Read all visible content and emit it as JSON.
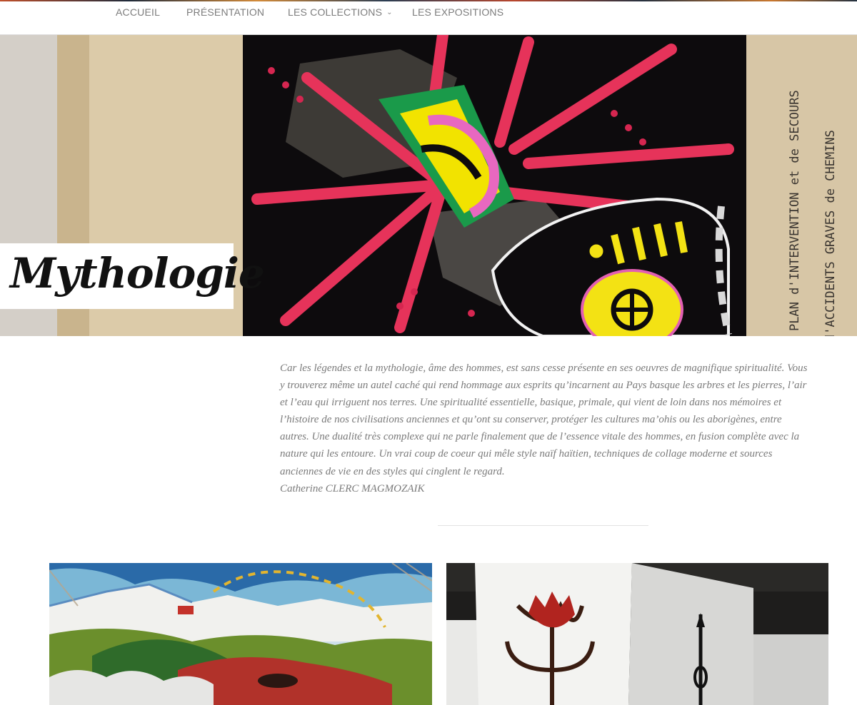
{
  "nav": {
    "items": [
      {
        "label": "ACCUEIL"
      },
      {
        "label": "PRÉSENTATION"
      },
      {
        "label": "LES COLLECTIONS",
        "dropdown_icon": "chevron-down-icon"
      },
      {
        "label": "LES EXPOSITIONS"
      }
    ]
  },
  "hero": {
    "title": "Mythologie",
    "embedded_text": [
      "PLAN d'INTERVENTION et de SECOURS",
      "d'ACCIDENTS GRAVES de CHEMINS"
    ]
  },
  "intro": {
    "paragraph": "Car les légendes et la mythologie, âme des hommes, est sans cesse présente en ses oeuvres de magnifique spiritualité. Vous y trouverez même un autel caché qui rend hommage aux esprits qu’incarnent au Pays basque les arbres et les pierres, l’air et l’eau qui irriguent nos terres. Une spiritualité essentielle, basique, primale, qui vient de loin dans nos mémoires et l’histoire de nos civilisations anciennes et qu’ont su conserver, protéger les cultures ma’ohis ou les aborigènes, entre autres. Une dualité très complexe qui ne parle finalement que de l’essence vitale des hommes, en fusion complète avec la nature qui les entoure. Un vrai coup de coeur qui mêle style naïf haïtien, techniques de collage moderne et sources anciennes de vie en des styles qui cinglent le regard.",
    "author": "Catherine CLERC MAGMOZAIK"
  },
  "colors": {
    "nav_text": "#7c7c7c",
    "body_text": "#7a7a7a",
    "title_text": "#111111",
    "accent_pink": "#e8345a"
  }
}
